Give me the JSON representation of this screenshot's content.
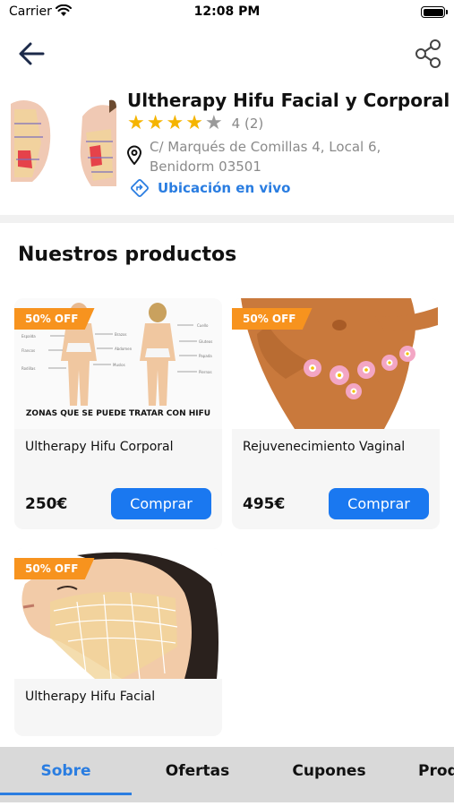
{
  "status_bar": {
    "carrier": "Carrier",
    "time": "12:08 PM"
  },
  "header": {
    "shop_name": "Ultherapy Hifu Facial y Corporal",
    "rating": 4,
    "rating_count": "4 (2)",
    "address": "C/ Marqués de Comillas 4, Local 6, Benidorm 03501",
    "live_location": "Ubicación en vivo"
  },
  "products_section": {
    "title": "Nuestros productos",
    "buy_label": "Comprar",
    "products": [
      {
        "name": "Ultherapy Hifu Corporal",
        "price": "250€",
        "badge": "50% OFF",
        "image_caption": "ZONAS QUE SE PUEDE TRATAR CON HIFU"
      },
      {
        "name": "Rejuvenecimiento Vaginal",
        "price": "495€",
        "badge": "50% OFF"
      },
      {
        "name": "Ultherapy Hifu Facial",
        "badge": "50% OFF"
      }
    ]
  },
  "tabs": [
    "Sobre",
    "Ofertas",
    "Cupones",
    "Prod"
  ],
  "active_tab": "Sobre",
  "colors": {
    "accent": "#2a7de1",
    "button": "#1a78f0",
    "badge": "#f7931e",
    "star": "#f5b400"
  }
}
